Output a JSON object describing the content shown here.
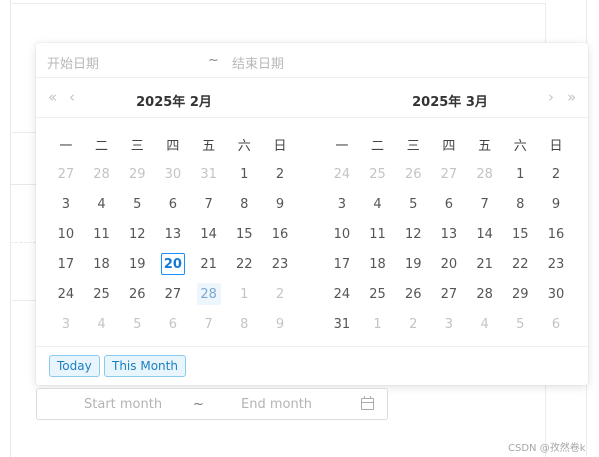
{
  "range_picker": {
    "start_placeholder": "开始日期",
    "separator": "~",
    "end_placeholder": "结束日期"
  },
  "left_panel": {
    "title": "2025年 2月",
    "nav_prev_year": "«",
    "nav_prev_month": "‹",
    "weekdays": [
      "一",
      "二",
      "三",
      "四",
      "五",
      "六",
      "日"
    ],
    "weeks": [
      [
        {
          "d": "27",
          "m": true
        },
        {
          "d": "28",
          "m": true
        },
        {
          "d": "29",
          "m": true
        },
        {
          "d": "30",
          "m": true
        },
        {
          "d": "31",
          "m": true
        },
        {
          "d": "1"
        },
        {
          "d": "2"
        }
      ],
      [
        {
          "d": "3"
        },
        {
          "d": "4"
        },
        {
          "d": "5"
        },
        {
          "d": "6"
        },
        {
          "d": "7"
        },
        {
          "d": "8"
        },
        {
          "d": "9"
        }
      ],
      [
        {
          "d": "10"
        },
        {
          "d": "11"
        },
        {
          "d": "12"
        },
        {
          "d": "13"
        },
        {
          "d": "14"
        },
        {
          "d": "15"
        },
        {
          "d": "16"
        }
      ],
      [
        {
          "d": "17"
        },
        {
          "d": "18"
        },
        {
          "d": "19"
        },
        {
          "d": "20",
          "today": true
        },
        {
          "d": "21"
        },
        {
          "d": "22"
        },
        {
          "d": "23"
        }
      ],
      [
        {
          "d": "24"
        },
        {
          "d": "25"
        },
        {
          "d": "26"
        },
        {
          "d": "27"
        },
        {
          "d": "28",
          "hover": true
        },
        {
          "d": "1",
          "m": true
        },
        {
          "d": "2",
          "m": true
        }
      ],
      [
        {
          "d": "3",
          "m": true
        },
        {
          "d": "4",
          "m": true
        },
        {
          "d": "5",
          "m": true
        },
        {
          "d": "6",
          "m": true
        },
        {
          "d": "7",
          "m": true
        },
        {
          "d": "8",
          "m": true
        },
        {
          "d": "9",
          "m": true
        }
      ]
    ]
  },
  "right_panel": {
    "title": "2025年 3月",
    "nav_next_month": "›",
    "nav_next_year": "»",
    "weekdays": [
      "一",
      "二",
      "三",
      "四",
      "五",
      "六",
      "日"
    ],
    "weeks": [
      [
        {
          "d": "24",
          "m": true
        },
        {
          "d": "25",
          "m": true
        },
        {
          "d": "26",
          "m": true
        },
        {
          "d": "27",
          "m": true
        },
        {
          "d": "28",
          "m": true
        },
        {
          "d": "1"
        },
        {
          "d": "2"
        }
      ],
      [
        {
          "d": "3"
        },
        {
          "d": "4"
        },
        {
          "d": "5"
        },
        {
          "d": "6"
        },
        {
          "d": "7"
        },
        {
          "d": "8"
        },
        {
          "d": "9"
        }
      ],
      [
        {
          "d": "10"
        },
        {
          "d": "11"
        },
        {
          "d": "12"
        },
        {
          "d": "13"
        },
        {
          "d": "14"
        },
        {
          "d": "15"
        },
        {
          "d": "16"
        }
      ],
      [
        {
          "d": "17"
        },
        {
          "d": "18"
        },
        {
          "d": "19"
        },
        {
          "d": "20"
        },
        {
          "d": "21"
        },
        {
          "d": "22"
        },
        {
          "d": "23"
        }
      ],
      [
        {
          "d": "24"
        },
        {
          "d": "25"
        },
        {
          "d": "26"
        },
        {
          "d": "27"
        },
        {
          "d": "28"
        },
        {
          "d": "29"
        },
        {
          "d": "30"
        }
      ],
      [
        {
          "d": "31"
        },
        {
          "d": "1",
          "m": true
        },
        {
          "d": "2",
          "m": true
        },
        {
          "d": "3",
          "m": true
        },
        {
          "d": "4",
          "m": true
        },
        {
          "d": "5",
          "m": true
        },
        {
          "d": "6",
          "m": true
        }
      ]
    ]
  },
  "footer": {
    "today_label": "Today",
    "this_month_label": "This Month"
  },
  "month_range": {
    "start_placeholder": "Start month",
    "separator": "~",
    "end_placeholder": "End month",
    "icon": "calendar-icon"
  },
  "watermark": "CSDN @孜然卷k",
  "colors": {
    "accent": "#1890ff",
    "tag_bg": "#e8f5fd",
    "tag_border": "#8dc9ec",
    "muted_text": "#c4c4c4"
  }
}
